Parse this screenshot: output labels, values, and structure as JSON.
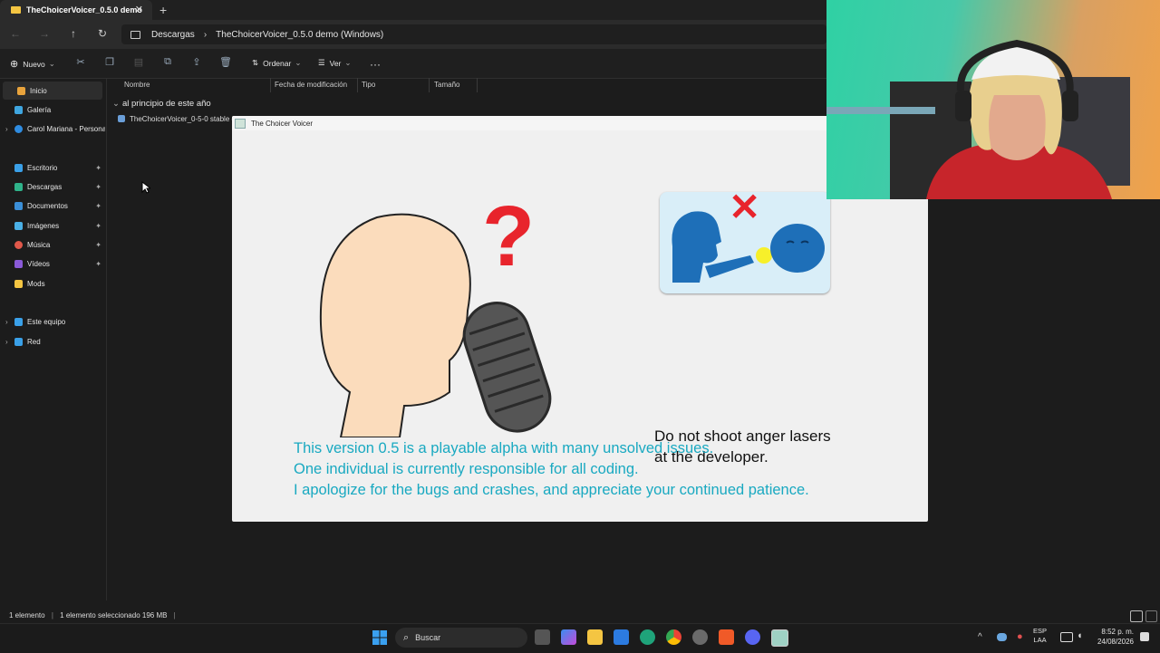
{
  "window": {
    "tab_title": "TheChoicerVoicer_0.5.0 demo",
    "close": "✕",
    "new_tab": "+"
  },
  "nav": {
    "back": "←",
    "forward": "→",
    "up": "↑",
    "refresh": "↻",
    "breadcrumb": [
      "Descargas",
      "TheChoicerVoicer_0.5.0 demo (Windows)"
    ],
    "sep": "›"
  },
  "toolbar": {
    "new": "Nuevo",
    "sort": "Ordenar",
    "view": "Ver",
    "more": "···"
  },
  "sidebar": {
    "items": [
      {
        "label": "Inicio"
      },
      {
        "label": "Galería"
      },
      {
        "label": "Carol Mariana - Personal"
      },
      {
        "label": "Escritorio"
      },
      {
        "label": "Descargas"
      },
      {
        "label": "Documentos"
      },
      {
        "label": "Imágenes"
      },
      {
        "label": "Música"
      },
      {
        "label": "Vídeos"
      },
      {
        "label": "Mods"
      },
      {
        "label": "Este equipo"
      },
      {
        "label": "Red"
      }
    ]
  },
  "columns": [
    "Nombre",
    "Fecha de modificación",
    "Tipo",
    "Tamaño"
  ],
  "group_label": "al principio de este año",
  "file_name": "TheChoicerVoicer_0-5-0 stable d",
  "statusbar": {
    "count": "1 elemento",
    "selection": "1 elemento seleccionado  196 MB"
  },
  "dialog": {
    "title": "The Choicer Voicer",
    "warning": [
      "Do not shoot anger lasers",
      "at the developer."
    ],
    "notice": [
      "This version 0.5 is a playable alpha with many unsolved issues.",
      "One individual is currently responsible for all coding.",
      "I apologize for the bugs and crashes, and appreciate your continued patience."
    ],
    "question_mark": "?",
    "x_mark": "✕"
  },
  "taskbar": {
    "search_placeholder": "Buscar",
    "lang": [
      "ESP",
      "LAA"
    ],
    "time": "8:52 p. m.",
    "date": "24/08/2026"
  },
  "colors": {
    "accent_teal": "#19a9c1",
    "question_red": "#e8242c",
    "folder_yellow": "#f4c542"
  }
}
